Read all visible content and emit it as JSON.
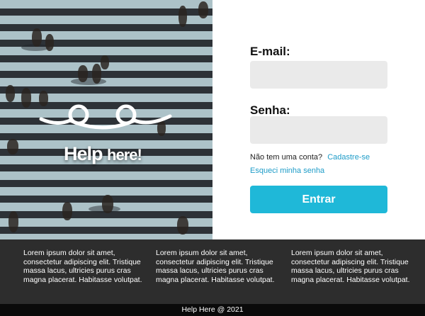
{
  "hero": {
    "logo_text_main": "Help",
    "logo_text_small": "here!"
  },
  "form": {
    "email_label": "E-mail:",
    "email_value": "",
    "password_label": "Senha:",
    "password_value": "",
    "no_account_text": "Não tem uma conta?",
    "signup_link": "Cadastre-se",
    "forgot_link": "Esqueci minha senha",
    "submit_label": "Entrar"
  },
  "footer": {
    "columns": [
      {
        "text": "Lorem ipsum dolor sit amet, consectetur adipiscing elit. Tristique massa lacus, ultricies purus cras magna placerat. Habitasse volutpat."
      },
      {
        "text": "Lorem ipsum dolor sit amet, consectetur adipiscing elit. Tristique massa lacus, ultricies purus cras magna placerat. Habitasse volutpat."
      },
      {
        "text": "Lorem ipsum dolor sit amet, consectetur adipiscing elit. Tristique massa lacus, ultricies purus cras magna placerat. Habitasse volutpat."
      }
    ],
    "copyright": "Help Here @ 2021"
  },
  "colors": {
    "accent": "#1fb8d8",
    "link": "#1e9cc8",
    "footer_bg": "#2d2d2d",
    "copyright_bg": "#0a0a0a",
    "field_bg": "#eaeaea"
  },
  "icons": {
    "logo": "smiling-eyes-logo-icon"
  }
}
